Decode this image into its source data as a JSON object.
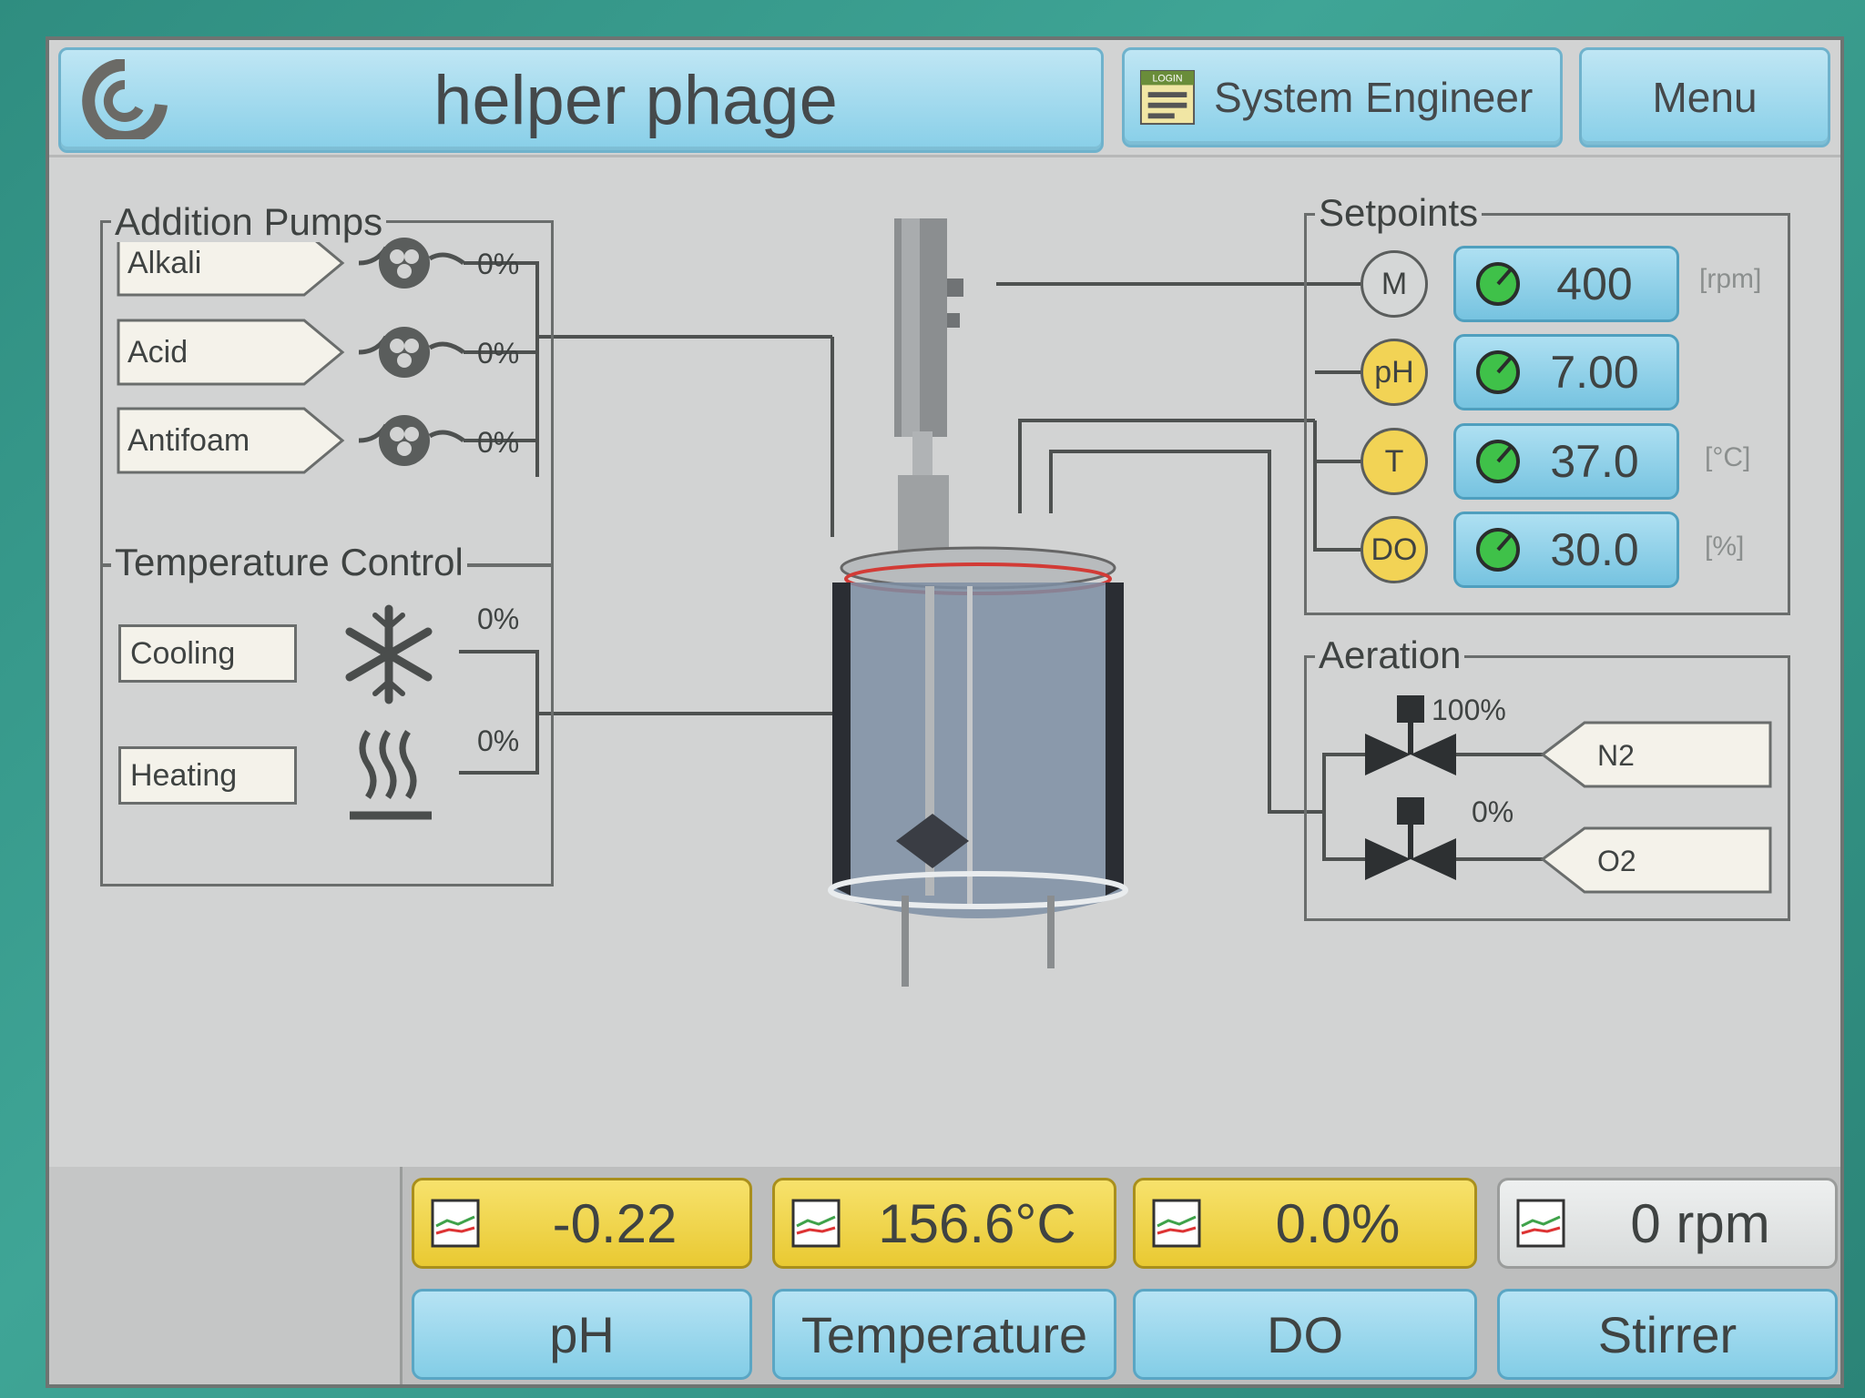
{
  "header": {
    "title": "helper phage",
    "user_label": "System Engineer",
    "login_badge": "LOGIN",
    "menu_label": "Menu"
  },
  "addition_pumps": {
    "title": "Addition Pumps",
    "items": [
      {
        "label": "Alkali",
        "value": "0%"
      },
      {
        "label": "Acid",
        "value": "0%"
      },
      {
        "label": "Antifoam",
        "value": "0%"
      }
    ]
  },
  "temperature_control": {
    "title": "Temperature Control",
    "items": [
      {
        "label": "Cooling",
        "value": "0%"
      },
      {
        "label": "Heating",
        "value": "0%"
      }
    ]
  },
  "setpoints": {
    "title": "Setpoints",
    "items": [
      {
        "node": "M",
        "value": "400",
        "unit": "[rpm]"
      },
      {
        "node": "pH",
        "value": "7.00",
        "unit": ""
      },
      {
        "node": "T",
        "value": "37.0",
        "unit": "[°C]"
      },
      {
        "node": "DO",
        "value": "30.0",
        "unit": "[%]"
      }
    ]
  },
  "aeration": {
    "title": "Aeration",
    "valves": [
      {
        "gas": "N2",
        "value": "100%"
      },
      {
        "gas": "O2",
        "value": "0%"
      }
    ]
  },
  "measurements": [
    {
      "value": "-0.22",
      "tab": "pH",
      "state": "alarm"
    },
    {
      "value": "156.6°C",
      "tab": "Temperature",
      "state": "alarm"
    },
    {
      "value": "0.0%",
      "tab": "DO",
      "state": "alarm"
    },
    {
      "value": "0 rpm",
      "tab": "Stirrer",
      "state": "normal"
    }
  ],
  "colors": {
    "screen_bg": "#d2d3d3",
    "button_blue": "#88cfe8",
    "alarm_yellow": "#f2d355",
    "bezel_green": "#3f9a8c"
  }
}
